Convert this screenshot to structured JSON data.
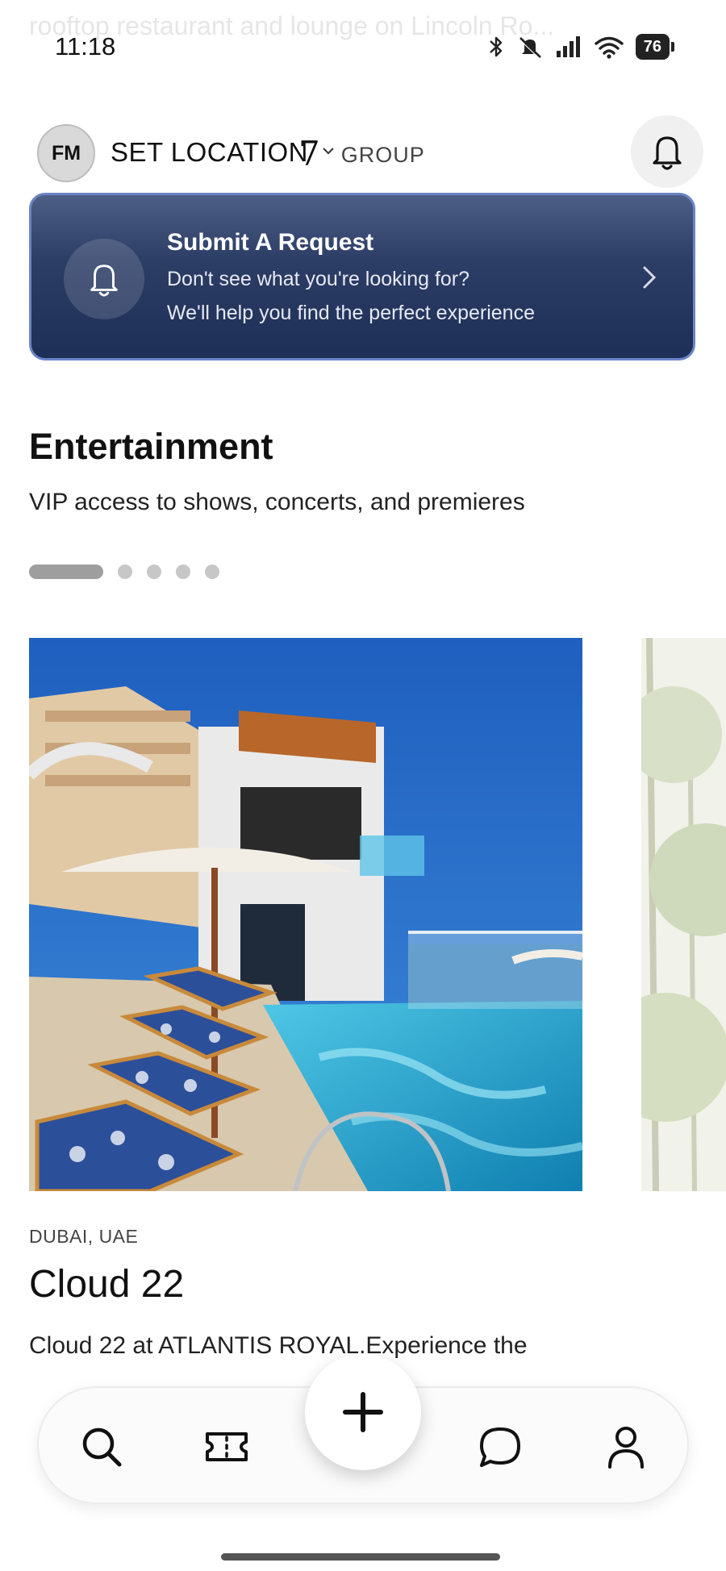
{
  "status_bar": {
    "time": "11:18",
    "battery": "76",
    "icons": [
      "bluetooth-icon",
      "mute-icon",
      "signal-icon",
      "wifi-icon",
      "battery-icon"
    ]
  },
  "ghost_text": "rooftop restaurant and lounge on Lincoln Ro...",
  "header": {
    "avatar_initials": "FM",
    "location_label": "SET LOCATION",
    "brand_logo": "7",
    "brand_text": "GROUP",
    "bell_icon": "bell-icon"
  },
  "request_card": {
    "title": "Submit A Request",
    "line1": "Don't see what you're looking for?",
    "line2": "We'll help you find the perfect experience"
  },
  "section": {
    "title": "Entertainment",
    "subtitle": "VIP access to shows, concerts, and premieres",
    "carousel_page": 1,
    "carousel_total": 5
  },
  "card": {
    "location": "DUBAI, UAE",
    "title": "Cloud 22",
    "description": "Cloud 22 at ATLANTIS ROYAL.Experience the"
  },
  "bottom_nav": {
    "items": [
      "search-icon",
      "ticket-icon",
      "add-icon",
      "chat-icon",
      "profile-icon"
    ]
  },
  "colors": {
    "card_gradient_top": "#4e5f86",
    "card_gradient_bottom": "#1e2f57",
    "card_border": "#6b84c7"
  }
}
